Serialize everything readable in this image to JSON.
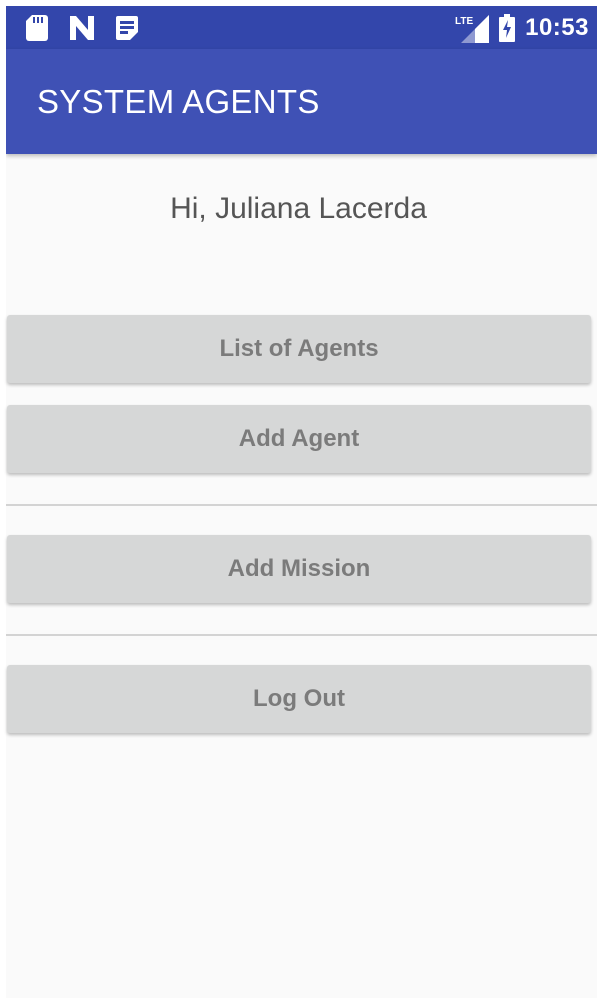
{
  "status_bar": {
    "time": "10:53",
    "network_label": "LTE",
    "colors": {
      "background": "#3346ab",
      "foreground": "#ffffff"
    },
    "icons": [
      "sd-card-icon",
      "n-notification-icon",
      "note-icon",
      "lte-signal-icon",
      "battery-charging-icon"
    ]
  },
  "app_bar": {
    "title": "SYSTEM AGENTS",
    "color": "#3f51b5"
  },
  "main": {
    "greeting": "Hi, Juliana Lacerda",
    "buttons": {
      "list_agents": "List of Agents",
      "add_agent": "Add Agent",
      "add_mission": "Add Mission",
      "log_out": "Log Out"
    }
  }
}
